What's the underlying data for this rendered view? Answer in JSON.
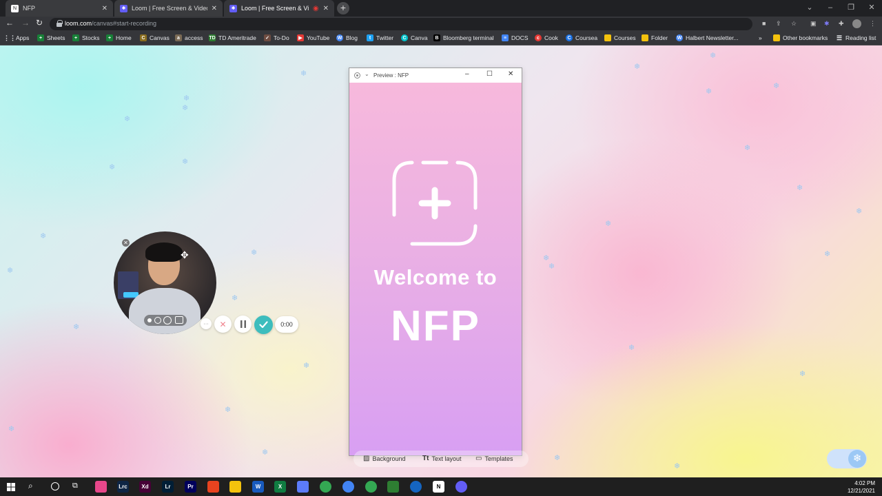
{
  "browser": {
    "tabs": [
      {
        "title": "NFP",
        "state": "inactive"
      },
      {
        "title": "Loom | Free Screen & Video Rec",
        "state": "inactive"
      },
      {
        "title": "Loom | Free Screen & Video",
        "state": "active"
      }
    ],
    "url_host": "loom.com",
    "url_path": "/canvas#start-recording",
    "bookmarks": [
      {
        "label": "Apps",
        "color": "#5f6368"
      },
      {
        "label": "Sheets",
        "color": "#188038"
      },
      {
        "label": "Stocks",
        "color": "#188038"
      },
      {
        "label": "Home",
        "color": "#188038"
      },
      {
        "label": "Canvas",
        "color": "#8a6d1f"
      },
      {
        "label": "access",
        "color": "#7a6a55"
      },
      {
        "label": "TD Ameritrade",
        "color": "#2e7d32"
      },
      {
        "label": "To-Do",
        "color": "#6d4c41"
      },
      {
        "label": "YouTube",
        "color": "#e53935"
      },
      {
        "label": "Blog",
        "color": "#4285f4"
      },
      {
        "label": "Twitter",
        "color": "#1da1f2"
      },
      {
        "label": "Canva",
        "color": "#00c4cc"
      },
      {
        "label": "Bloomberg terminal",
        "color": "#000000"
      },
      {
        "label": "DOCS",
        "color": "#4285f4"
      },
      {
        "label": "Cook",
        "color": "#e53935"
      },
      {
        "label": "Coursea",
        "color": "#1a73e8"
      },
      {
        "label": "Courses",
        "color": "#f4c20d"
      },
      {
        "label": "Folder",
        "color": "#f4c20d"
      },
      {
        "label": "Halbert Newsletter...",
        "color": "#4285f4"
      }
    ],
    "more_bookmarks": "»",
    "other_bookmarks": "Other bookmarks",
    "reading_list": "Reading list"
  },
  "preview": {
    "title": "Preview : NFP",
    "welcome": "Welcome to",
    "brand": "NFP"
  },
  "toolbar": {
    "background": "Background",
    "text_layout": "Text layout",
    "templates": "Templates"
  },
  "recorder": {
    "more": "···",
    "timer": "0:00"
  },
  "taskbar": {
    "time": "4:02 PM",
    "date": "12/21/2021",
    "apps": [
      {
        "label": "",
        "color": "#e7478a"
      },
      {
        "label": "Lrc",
        "color": "#0e2544"
      },
      {
        "label": "Xd",
        "color": "#470137"
      },
      {
        "label": "Lr",
        "color": "#001e36"
      },
      {
        "label": "Pr",
        "color": "#00005b"
      },
      {
        "label": "",
        "color": "#e8431f"
      },
      {
        "label": "",
        "color": "#f4c20d"
      },
      {
        "label": "W",
        "color": "#185abd"
      },
      {
        "label": "X",
        "color": "#107c41"
      },
      {
        "label": "",
        "color": "#5c7cfa"
      },
      {
        "label": "",
        "color": "#34a853"
      },
      {
        "label": "",
        "color": "#4285f4"
      },
      {
        "label": "",
        "color": "#34a853"
      },
      {
        "label": "",
        "color": "#2e7d32"
      },
      {
        "label": "",
        "color": "#1565c0"
      },
      {
        "label": "N",
        "color": "#ffffff"
      },
      {
        "label": "",
        "color": "#625df5"
      }
    ]
  },
  "colors": {
    "accent_check": "#3dbdbd",
    "cancel_x": "#f0838e",
    "preview_top": "#f7b9dc",
    "preview_bottom": "#d89ff3"
  }
}
